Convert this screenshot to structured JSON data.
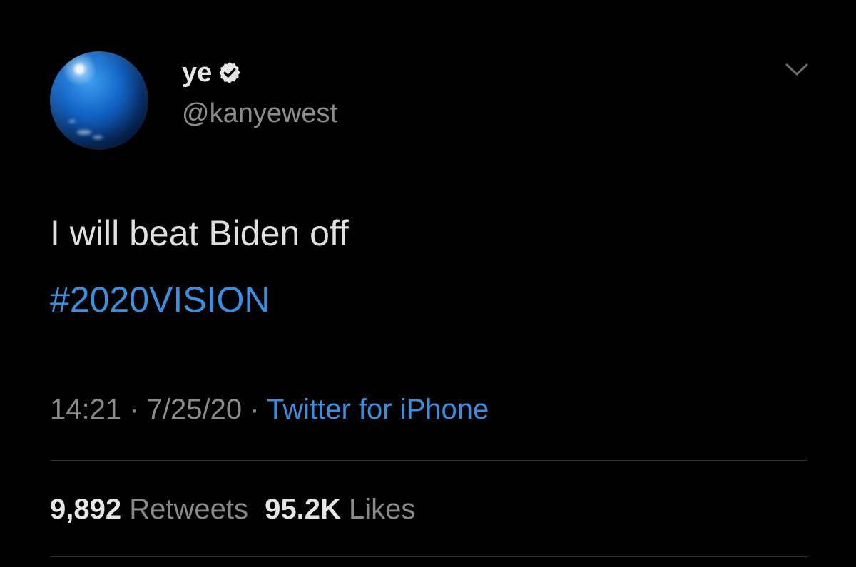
{
  "author": {
    "display_name": "ye",
    "handle": "@kanyewest",
    "verified": true,
    "avatar_icon": "blue-globe-avatar"
  },
  "tweet": {
    "text": "I will beat Biden off",
    "hashtag": "#2020VISION"
  },
  "meta": {
    "time": "14:21",
    "separator": "·",
    "date": "7/25/20",
    "source": "Twitter for iPhone"
  },
  "stats": {
    "retweets_count": "9,892",
    "retweets_label": "Retweets",
    "likes_count": "95.2K",
    "likes_label": "Likes"
  },
  "colors": {
    "background": "#000000",
    "link_blue": "#3a8fde",
    "muted_text": "#8a8a8a",
    "primary_text": "#e6e6e6",
    "divider": "#2f2f2f"
  },
  "icons": {
    "verified": "verified-badge-icon",
    "more": "chevron-down-icon"
  }
}
